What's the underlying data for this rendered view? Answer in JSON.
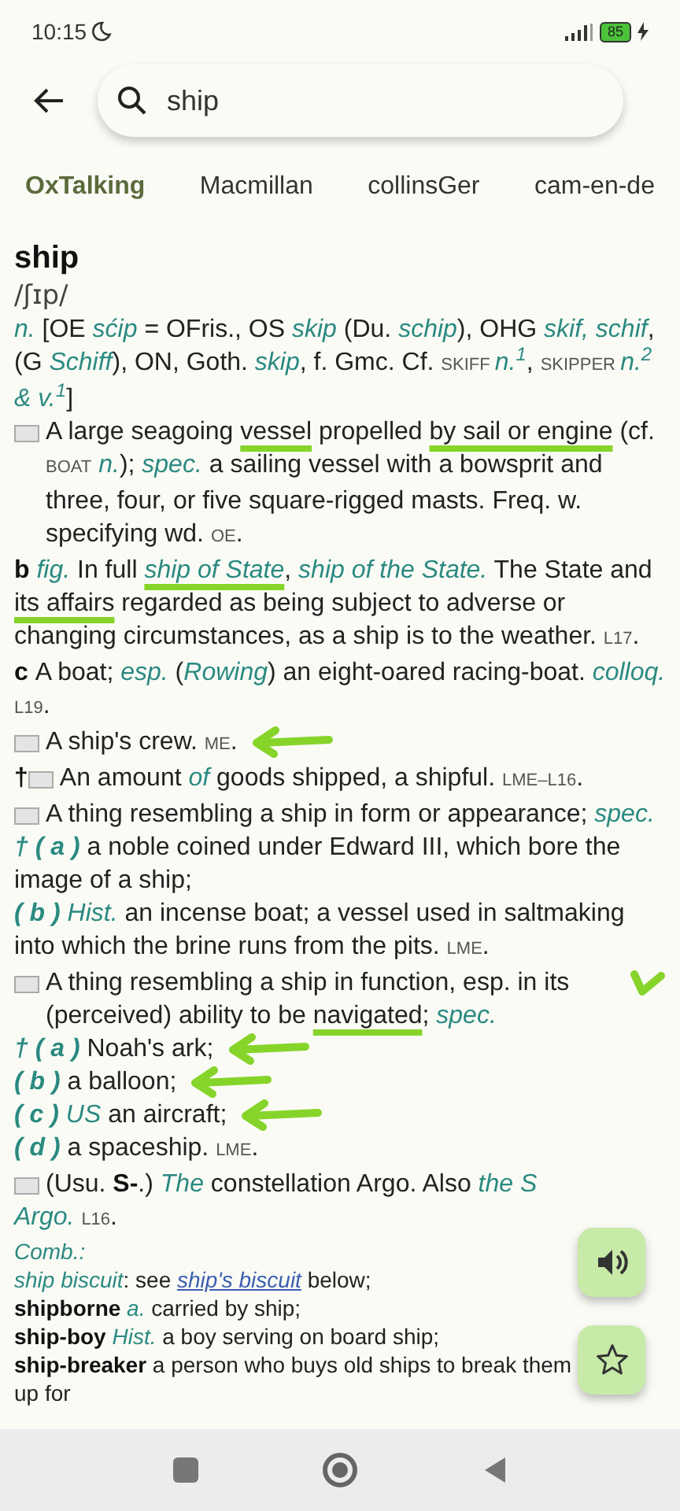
{
  "status_bar": {
    "time": "10:15",
    "battery": "85"
  },
  "search": {
    "value": "ship"
  },
  "tabs": [
    {
      "label": "OxTalking",
      "selected": true
    },
    {
      "label": "Macmillan",
      "selected": false
    },
    {
      "label": "collinsGer",
      "selected": false
    },
    {
      "label": "cam-en-de",
      "selected": false
    }
  ],
  "entry": {
    "headword": "ship",
    "pronunciation": "/ʃɪp/",
    "senses": [
      {
        "icon": false,
        "arrow": false,
        "check": false,
        "segments": [
          {
            "kind": "term",
            "text": "n."
          },
          {
            "kind": "plain",
            "text": " [OE "
          },
          {
            "kind": "term",
            "text": "sćip"
          },
          {
            "kind": "plain",
            "text": " = OFris., OS "
          },
          {
            "kind": "term",
            "text": "skip"
          },
          {
            "kind": "plain",
            "text": " (Du. "
          },
          {
            "kind": "term",
            "text": "schip"
          },
          {
            "kind": "plain",
            "text": "), OHG "
          },
          {
            "kind": "term",
            "text": "skif, schif"
          },
          {
            "kind": "plain",
            "text": ", (G "
          },
          {
            "kind": "term",
            "text": "Schiff"
          },
          {
            "kind": "plain",
            "text": "), ON, Goth. "
          },
          {
            "kind": "term",
            "text": "skip"
          },
          {
            "kind": "plain",
            "text": ", f. Gmc. Cf. "
          },
          {
            "kind": "sc",
            "text": "SKIFF "
          },
          {
            "kind": "term",
            "text": "n.$^{1}$"
          },
          {
            "kind": "plain",
            "text": ", "
          },
          {
            "kind": "sc",
            "text": "SKIPPER "
          },
          {
            "kind": "term",
            "text": "n.$^{2}$ & v.$^{1}$"
          },
          {
            "kind": "plain",
            "text": "]"
          }
        ]
      },
      {
        "icon": true,
        "arrow": false,
        "check": false,
        "segments": [
          {
            "kind": "plain",
            "text": "A large seagoing "
          },
          {
            "kind": "plain",
            "text": "vessel",
            "marked": true
          },
          {
            "kind": "plain",
            "text": " propelled "
          },
          {
            "kind": "plain",
            "text": "by sail or engine",
            "marked": true
          },
          {
            "kind": "plain",
            "text": " (cf. "
          },
          {
            "kind": "sc",
            "text": "BOAT"
          },
          {
            "kind": "term",
            "text": " n."
          },
          {
            "kind": "plain",
            "text": "); "
          },
          {
            "kind": "term",
            "text": "spec."
          },
          {
            "kind": "plain",
            "text": " a sailing vessel with a bowsprit and three, four, or five square-rigged masts. Freq. w. specifying wd. "
          },
          {
            "kind": "sc",
            "text": "OE"
          },
          {
            "kind": "plain",
            "text": "."
          }
        ]
      },
      {
        "icon": false,
        "arrow": false,
        "check": false,
        "segments": [
          {
            "kind": "bold",
            "text": "b "
          },
          {
            "kind": "term",
            "text": "fig."
          },
          {
            "kind": "plain",
            "text": " In full "
          },
          {
            "kind": "term",
            "text": "ship of State",
            "marked": true
          },
          {
            "kind": "plain",
            "text": ", "
          },
          {
            "kind": "term",
            "text": "ship of the State."
          },
          {
            "kind": "plain",
            "text": " The State and "
          },
          {
            "kind": "plain",
            "text": "its affairs",
            "marked": true
          },
          {
            "kind": "plain",
            "text": " regarded as being subject to adverse or changing circumstances, as a ship is to the weather. "
          },
          {
            "kind": "sc",
            "text": "L17"
          },
          {
            "kind": "plain",
            "text": "."
          }
        ]
      },
      {
        "icon": false,
        "arrow": false,
        "check": false,
        "segments": [
          {
            "kind": "bold",
            "text": "c "
          },
          {
            "kind": "plain",
            "text": "A boat; "
          },
          {
            "kind": "term",
            "text": "esp."
          },
          {
            "kind": "plain",
            "text": " ("
          },
          {
            "kind": "term",
            "text": "Rowing"
          },
          {
            "kind": "plain",
            "text": ") an eight-oared racing-boat. "
          },
          {
            "kind": "term",
            "text": "colloq. "
          },
          {
            "kind": "sc",
            "text": "L19"
          },
          {
            "kind": "plain",
            "text": "."
          }
        ]
      },
      {
        "icon": true,
        "arrow": true,
        "check": false,
        "segments": [
          {
            "kind": "plain",
            "text": "A ship's crew. "
          },
          {
            "kind": "sc",
            "text": "ME"
          },
          {
            "kind": "plain",
            "text": "."
          }
        ]
      },
      {
        "mark": "†",
        "icon": true,
        "arrow": false,
        "check": false,
        "segments": [
          {
            "kind": "plain",
            "text": "An amount "
          },
          {
            "kind": "term",
            "text": "of"
          },
          {
            "kind": "plain",
            "text": " goods shipped, a shipful. "
          },
          {
            "kind": "sc",
            "text": "LME–L16"
          },
          {
            "kind": "plain",
            "text": "."
          }
        ]
      },
      {
        "icon": true,
        "arrow": false,
        "check": false,
        "segments": [
          {
            "kind": "plain",
            "text": "A thing resembling a ship in form or appearance; "
          },
          {
            "kind": "term",
            "text": "spec."
          }
        ]
      },
      {
        "icon": false,
        "arrow": false,
        "check": false,
        "segments": [
          {
            "kind": "sense",
            "text": "† ( a )"
          },
          {
            "kind": "plain",
            "text": " a noble coined under Edward III, which bore the image of a ship;"
          }
        ]
      },
      {
        "icon": false,
        "arrow": false,
        "check": false,
        "segments": [
          {
            "kind": "sense",
            "text": "( b )"
          },
          {
            "kind": "term",
            "text": " Hist."
          },
          {
            "kind": "plain",
            "text": " an incense boat; a vessel used in saltmaking into which the brine runs from the pits. "
          },
          {
            "kind": "sc",
            "text": "LME"
          },
          {
            "kind": "plain",
            "text": "."
          }
        ]
      },
      {
        "icon": true,
        "arrow": false,
        "check": true,
        "segments": [
          {
            "kind": "plain",
            "text": "A thing resembling a ship in function, esp. in its (perceived) ability to be "
          },
          {
            "kind": "plain",
            "text": "navigated",
            "marked": true
          },
          {
            "kind": "plain",
            "text": "; "
          },
          {
            "kind": "term",
            "text": "spec."
          }
        ]
      },
      {
        "icon": false,
        "arrow": true,
        "check": false,
        "segments": [
          {
            "kind": "sense",
            "text": "† ( a )"
          },
          {
            "kind": "plain",
            "text": " Noah's ark;"
          }
        ]
      },
      {
        "icon": false,
        "arrow": true,
        "check": false,
        "segments": [
          {
            "kind": "sense",
            "text": "( b )"
          },
          {
            "kind": "plain",
            "text": " a balloon;"
          }
        ]
      },
      {
        "icon": false,
        "arrow": true,
        "check": false,
        "segments": [
          {
            "kind": "sense",
            "text": "( c )"
          },
          {
            "kind": "term",
            "text": " US"
          },
          {
            "kind": "plain",
            "text": " an aircraft;"
          }
        ]
      },
      {
        "icon": false,
        "arrow": false,
        "check": false,
        "segments": [
          {
            "kind": "sense",
            "text": "( d )"
          },
          {
            "kind": "plain",
            "text": " a spaceship. "
          },
          {
            "kind": "sc",
            "text": "LME"
          },
          {
            "kind": "plain",
            "text": "."
          }
        ]
      },
      {
        "icon": true,
        "arrow": false,
        "check": false,
        "segments": [
          {
            "kind": "plain",
            "text": "(Usu. "
          },
          {
            "kind": "bold",
            "text": "S-"
          },
          {
            "kind": "plain",
            "text": ".) "
          },
          {
            "kind": "term",
            "text": "The"
          },
          {
            "kind": "plain",
            "text": " constellation Argo. Also "
          },
          {
            "kind": "term",
            "text": "the S"
          }
        ]
      },
      {
        "icon": false,
        "arrow": false,
        "check": false,
        "segments": [
          {
            "kind": "term",
            "text": "Argo. "
          },
          {
            "kind": "sc",
            "text": "L16"
          },
          {
            "kind": "plain",
            "text": "."
          }
        ]
      }
    ],
    "combinations": [
      {
        "segments": [
          {
            "kind": "term",
            "text": "Comb.:"
          }
        ]
      },
      {
        "segments": [
          {
            "kind": "term",
            "text": "ship biscuit"
          },
          {
            "kind": "plain",
            "text": ": see "
          },
          {
            "kind": "link",
            "text": "ship's biscuit"
          },
          {
            "kind": "plain",
            "text": " below;"
          }
        ]
      },
      {
        "segments": [
          {
            "kind": "bold",
            "text": "shipborne"
          },
          {
            "kind": "term",
            "text": " a."
          },
          {
            "kind": "plain",
            "text": " carried by ship;"
          }
        ]
      },
      {
        "segments": [
          {
            "kind": "bold",
            "text": "ship-boy"
          },
          {
            "kind": "term",
            "text": " Hist."
          },
          {
            "kind": "plain",
            "text": " a boy serving on board ship;"
          }
        ]
      },
      {
        "segments": [
          {
            "kind": "bold",
            "text": "ship-breaker"
          },
          {
            "kind": "plain",
            "text": " a person who buys old ships to break them up for"
          }
        ]
      }
    ]
  }
}
